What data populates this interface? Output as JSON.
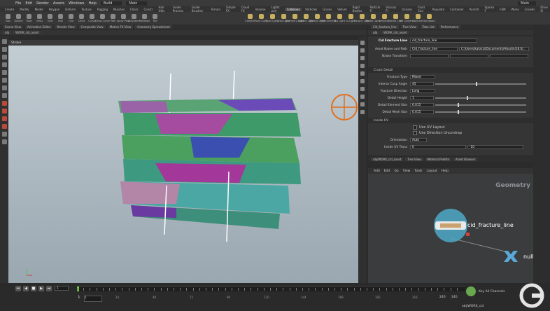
{
  "menu": [
    "File",
    "Edit",
    "Render",
    "Assets",
    "Windows",
    "Help"
  ],
  "build_label": "Build",
  "desktop_label": "Main",
  "shelf_tabs": [
    "Create",
    "Modify",
    "Model",
    "Polygon",
    "Deform",
    "Texture",
    "Rigging",
    "Muscles",
    "Chars",
    "Constr",
    "Hair Utils",
    "Guide Process",
    "Guide Brushes",
    "Terrain",
    "Simple FX",
    "Cloud FX",
    "Volume",
    "Lights and",
    "Collisions",
    "Particles",
    "Grains",
    "Vellum",
    "Rigid Bodies",
    "Particle Fl",
    "Viscous Fl",
    "Oceans",
    "Fluid Con",
    "Populate",
    "Container",
    "PyroFX",
    "Sparse F",
    "FEM",
    "Wires",
    "Crowds",
    "Drive Si"
  ],
  "tools": [
    "Box",
    "Sphere",
    "Tube",
    "Torus",
    "Grid",
    "Null",
    "Line",
    "Circle",
    "Curve",
    "Draw Curve",
    "Path",
    "Spray Paint",
    "L-System",
    "Metaball",
    "File"
  ],
  "light_tools": [
    "Camera",
    "Point Light",
    "Spot Light",
    "Area Light",
    "Geometry Light",
    "Volume Light",
    "Distant Light",
    "Environment",
    "Sky Light",
    "GI Light",
    "Caustic Light",
    "Portal Light",
    "Ambient",
    "Stereo Cam",
    "VR Camera",
    "Switcher",
    "Gamepad"
  ],
  "left_tabs": [
    "Scene View",
    "Animation Editor",
    "Render View",
    "Composite View",
    "Motion FX View",
    "Geometry Spreadsheet"
  ],
  "viewport_path": [
    "obj",
    "WORK_cid_asset"
  ],
  "viewport_tool": "Stroke",
  "right_tabs": [
    "Cid_fracture_line",
    "Tree View",
    "Take List",
    "Performance"
  ],
  "param_path": [
    "obj",
    "WORK_cid_asset"
  ],
  "node_type": "Cid Fracture Line",
  "node_name": "cid_fracture_line",
  "asset_name_label": "Asset Name and Path",
  "asset_name_value": "Cid_fracture_line",
  "asset_path_value": "C:/Users/katarzi/Documents/Houdini18.0/...",
  "stroke_label": "Stroke Transform",
  "crack_section": "Crack Detail",
  "params": [
    {
      "label": "Fracture Type",
      "value": "Mixed",
      "kind": "menu"
    },
    {
      "label": "Interior Cusp Angle",
      "value": "45",
      "kind": "slider",
      "pos": 0.45
    },
    {
      "label": "Fracture Direction",
      "value": "Long",
      "kind": "menu"
    },
    {
      "label": "Detail Height",
      "value": "1",
      "kind": "slider",
      "pos": 0.35
    },
    {
      "label": "Detail Element Size",
      "value": "0.015",
      "kind": "slider",
      "pos": 0.25
    },
    {
      "label": "Detail Mesh Size",
      "value": "0.015",
      "kind": "slider",
      "pos": 0.25
    }
  ],
  "inside_section": "Inside UV",
  "uv_checks": [
    "Use UV Layout",
    "Use Direction Uncontrap"
  ],
  "orientation_label": "Orientation",
  "orientation_value": "Auto",
  "inside_uv_label": "Inside UV Trans",
  "inside_uv_value": "0",
  "inside_uv_value2": "-10",
  "net_tabs": [
    "obj/WORK_cid_asset",
    "Tree View",
    "Material Palette",
    "Asset Browser"
  ],
  "net_path": [
    "obj",
    "WORK_cid_asset"
  ],
  "net_menu": [
    "Add",
    "Edit",
    "Go",
    "View",
    "Tools",
    "Layout",
    "Help"
  ],
  "net_context": "Geometry",
  "nodes": [
    {
      "name": "cid_fracture_line",
      "kind": "hda"
    },
    {
      "name": "null",
      "kind": "null"
    }
  ],
  "timeline": {
    "frame": "1",
    "start": "1",
    "end": "240",
    "end2": "240",
    "ticks": [
      "1",
      "24",
      "48",
      "72",
      "96",
      "120",
      "144",
      "168",
      "192",
      "216"
    ]
  },
  "status_path": "obj/WORK_cid",
  "key_label": "Key All Channels",
  "watermark": "G"
}
